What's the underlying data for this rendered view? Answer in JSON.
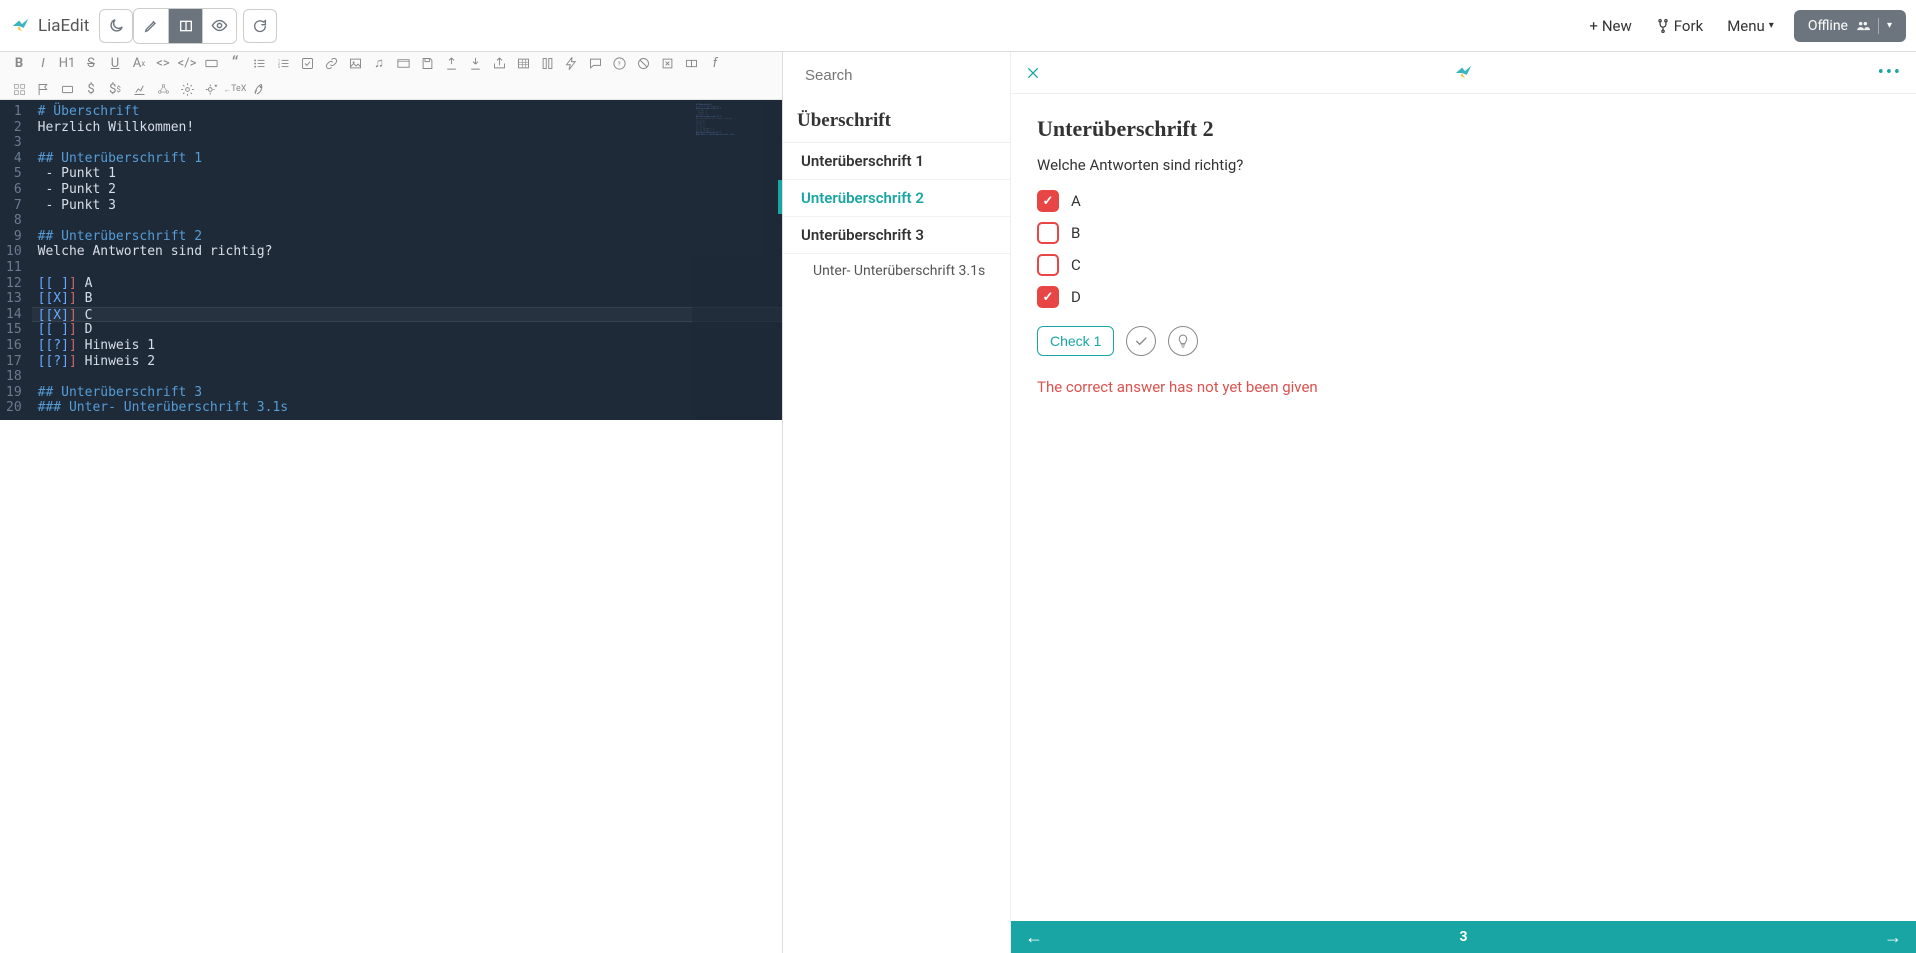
{
  "app": {
    "name": "LiaEdit"
  },
  "topbar": {
    "new": "New",
    "fork": "Fork",
    "menu": "Menu",
    "offline": "Offline"
  },
  "editor": {
    "lines": [
      {
        "n": 1,
        "segments": [
          [
            "head",
            "# Überschrift"
          ]
        ]
      },
      {
        "n": 2,
        "segments": [
          [
            "text",
            "Herzlich Willkommen!"
          ]
        ]
      },
      {
        "n": 3,
        "segments": []
      },
      {
        "n": 4,
        "segments": [
          [
            "head",
            "## Unterüberschrift 1"
          ]
        ]
      },
      {
        "n": 5,
        "segments": [
          [
            "text",
            " - Punkt 1"
          ]
        ]
      },
      {
        "n": 6,
        "segments": [
          [
            "text",
            " - Punkt 2"
          ]
        ]
      },
      {
        "n": 7,
        "segments": [
          [
            "text",
            " - Punkt 3"
          ]
        ]
      },
      {
        "n": 8,
        "segments": []
      },
      {
        "n": 9,
        "segments": [
          [
            "head",
            "## Unterüberschrift 2"
          ]
        ]
      },
      {
        "n": 10,
        "segments": [
          [
            "text",
            "Welche Antworten sind richtig?"
          ]
        ]
      },
      {
        "n": 11,
        "segments": []
      },
      {
        "n": 12,
        "segments": [
          [
            "bracket",
            "[[ ]"
          ],
          [
            "punct",
            "]"
          ],
          [
            "text",
            " A"
          ]
        ]
      },
      {
        "n": 13,
        "segments": [
          [
            "bracket",
            "[[X]"
          ],
          [
            "punct",
            "]"
          ],
          [
            "text",
            " B"
          ]
        ]
      },
      {
        "n": 14,
        "segments": [
          [
            "bracket",
            "[[X]"
          ],
          [
            "punct",
            "]"
          ],
          [
            "text",
            " C"
          ]
        ],
        "cursor": true
      },
      {
        "n": 15,
        "segments": [
          [
            "bracket",
            "[[ ]"
          ],
          [
            "punct",
            "]"
          ],
          [
            "text",
            " D"
          ]
        ]
      },
      {
        "n": 16,
        "segments": [
          [
            "bracket",
            "[[?]"
          ],
          [
            "punct",
            "]"
          ],
          [
            "text",
            " Hinweis 1"
          ]
        ]
      },
      {
        "n": 17,
        "segments": [
          [
            "bracket",
            "[[?]"
          ],
          [
            "punct",
            "]"
          ],
          [
            "text",
            " Hinweis 2"
          ]
        ]
      },
      {
        "n": 18,
        "segments": []
      },
      {
        "n": 19,
        "segments": [
          [
            "head",
            "## Unterüberschrift 3"
          ]
        ]
      },
      {
        "n": 20,
        "segments": [
          [
            "head",
            "### Unter- Unterüberschrift 3.1s"
          ]
        ]
      }
    ]
  },
  "toc": {
    "search_placeholder": "Search",
    "title": "Überschrift",
    "items": [
      {
        "label": "Unterüberschrift 1",
        "active": false
      },
      {
        "label": "Unterüberschrift 2",
        "active": true
      },
      {
        "label": "Unterüberschrift 3",
        "active": false
      }
    ],
    "sub": "Unter- Unterüberschrift 3.1s"
  },
  "content": {
    "heading": "Unterüberschrift 2",
    "question": "Welche Antworten sind richtig?",
    "options": [
      {
        "label": "A",
        "checked": true
      },
      {
        "label": "B",
        "checked": false
      },
      {
        "label": "C",
        "checked": false
      },
      {
        "label": "D",
        "checked": true
      }
    ],
    "check_label": "Check 1",
    "feedback": "The correct answer has not yet been given"
  },
  "pager": {
    "page": "3"
  }
}
